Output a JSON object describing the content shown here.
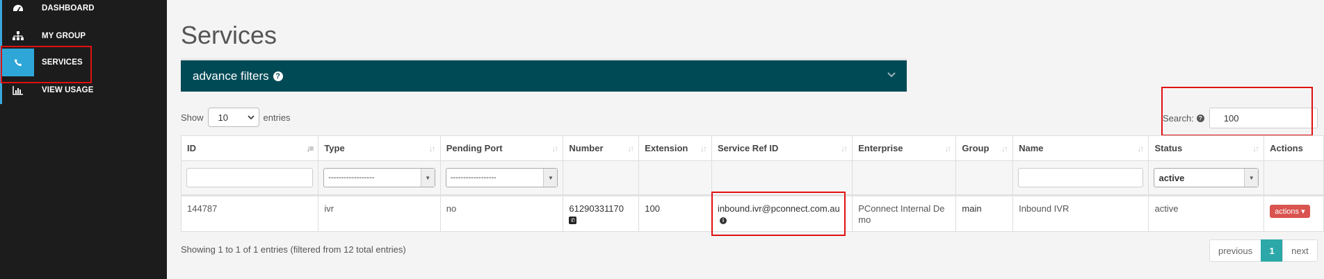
{
  "sidebar": {
    "items": [
      {
        "label": "DASHBOARD",
        "icon": "dashboard-icon"
      },
      {
        "label": "MY GROUP",
        "icon": "sitemap-icon"
      },
      {
        "label": "SERVICES",
        "icon": "phone-icon"
      },
      {
        "label": "VIEW USAGE",
        "icon": "bar-chart-icon"
      }
    ]
  },
  "page": {
    "title": "Services"
  },
  "filters_panel": {
    "label": "advance filters"
  },
  "length": {
    "show": "Show",
    "value": "10",
    "entries": "entries"
  },
  "search": {
    "label": "Search:",
    "value": "100"
  },
  "table": {
    "headers": [
      "ID",
      "Type",
      "Pending Port",
      "Number",
      "Extension",
      "Service Ref ID",
      "Enterprise",
      "Group",
      "Name",
      "Status",
      "Actions"
    ],
    "filter_row": {
      "type_select": "------------------",
      "pending_select": "------------------",
      "status_select": "active"
    },
    "row": {
      "id": "144787",
      "type": "ivr",
      "pending_port": "no",
      "number": "61290331170",
      "extension": "100",
      "service_ref_id": "inbound.ivr@pconnect.com.au",
      "enterprise": "PConnect Internal Demo",
      "group": "main",
      "name": "Inbound IVR",
      "status": "active",
      "actions_label": "actions"
    }
  },
  "footer": {
    "info": "Showing 1 to 1 of 1 entries (filtered from 12 total entries)"
  },
  "pagination": {
    "previous": "previous",
    "current": "1",
    "next": "next"
  },
  "colors": {
    "sidebar_bg": "#1c1c1c",
    "accent_blue": "#2ea7d8",
    "filter_panel": "#004a56",
    "highlight_red": "#e01010",
    "action_red": "#d9534f",
    "page_teal": "#2ca8a8"
  }
}
